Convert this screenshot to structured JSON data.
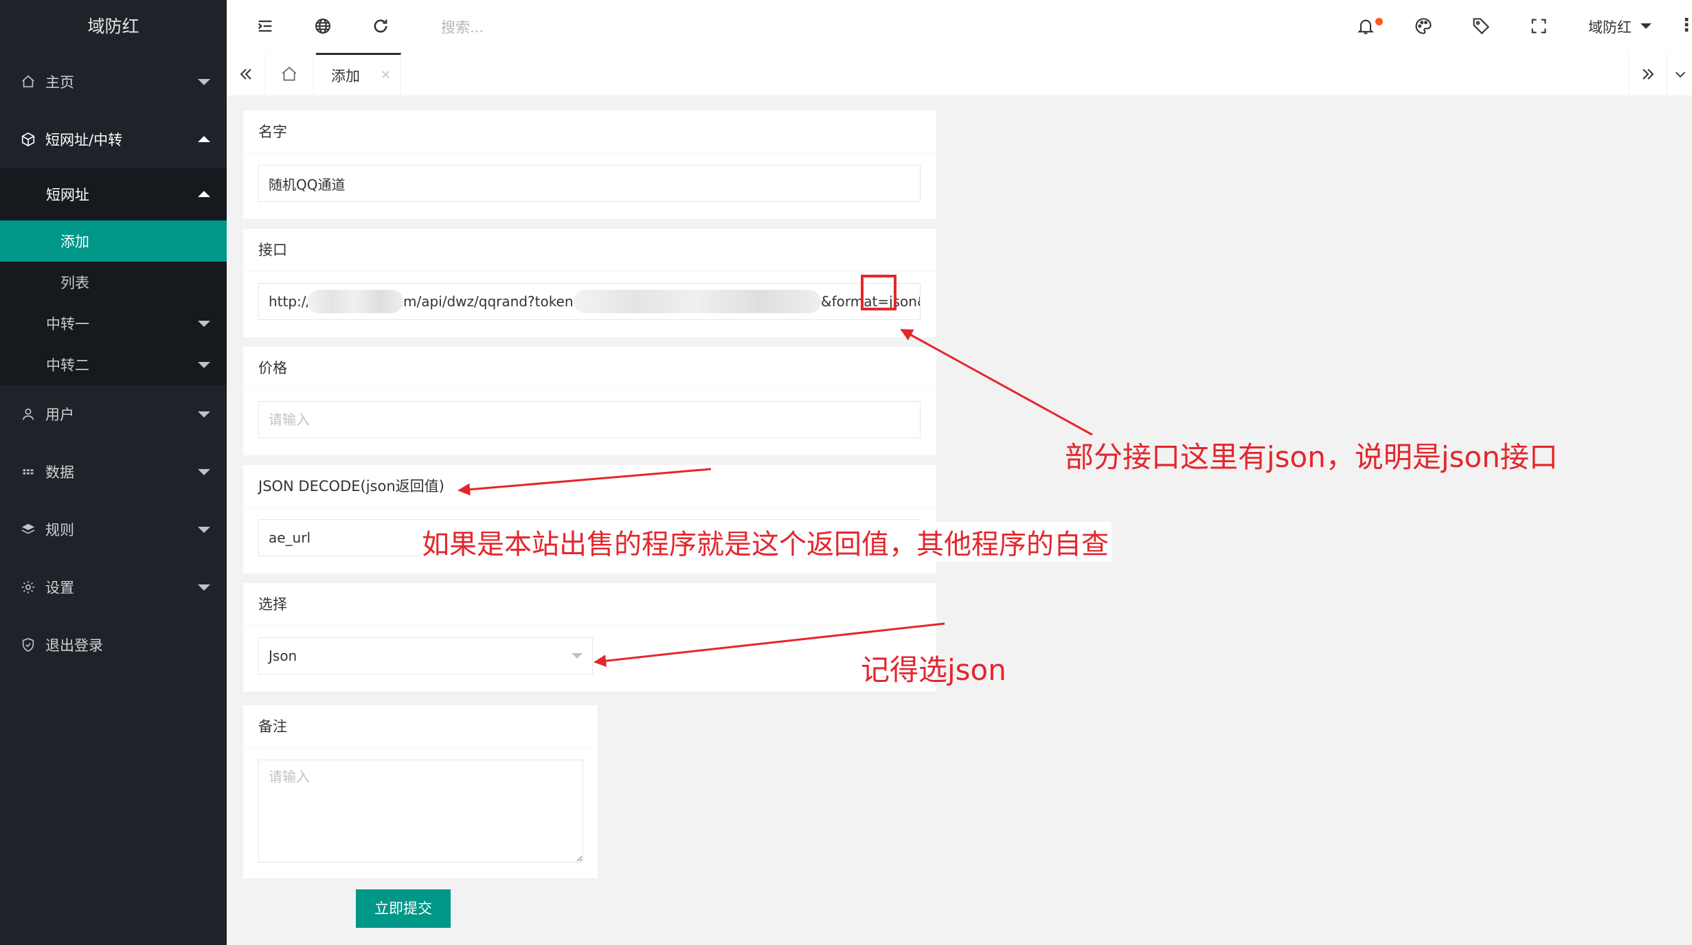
{
  "app": {
    "brand": "域防红"
  },
  "sidebar": {
    "items": [
      {
        "label": "主页",
        "icon": "home-icon"
      },
      {
        "label": "短网址/中转",
        "icon": "box-icon"
      },
      {
        "label": "用户",
        "icon": "user-icon"
      },
      {
        "label": "数据",
        "icon": "grid-icon"
      },
      {
        "label": "规则",
        "icon": "layers-icon"
      },
      {
        "label": "设置",
        "icon": "gear-icon"
      },
      {
        "label": "退出登录",
        "icon": "shield-icon"
      }
    ],
    "sub": {
      "short_url": "短网址",
      "add": "添加",
      "list": "列表",
      "relay1": "中转一",
      "relay2": "中转二"
    }
  },
  "header": {
    "search_placeholder": "搜索...",
    "user": "域防红",
    "more": "⋮",
    "icons": [
      "menu-fold-icon",
      "globe-icon",
      "refresh-icon",
      "bell-icon",
      "palette-icon",
      "tag-icon",
      "fullscreen-icon"
    ]
  },
  "tabs": {
    "active": "添加",
    "close": "×"
  },
  "form": {
    "name": {
      "label": "名字",
      "value": "随机QQ通道"
    },
    "api": {
      "label": "接口",
      "seg1": "http://c",
      "seg2": "m/api/dwz/qqrand?token=",
      "seg3": "&format=json&long"
    },
    "price": {
      "label": "价格",
      "placeholder": "请输入"
    },
    "json_decode": {
      "label": "JSON DECODE(json返回值)",
      "value": "ae_url"
    },
    "select": {
      "label": "选择",
      "value": "Json"
    },
    "remark": {
      "label": "备注",
      "placeholder": "请输入"
    },
    "submit": "立即提交"
  },
  "annotations": {
    "a1": "部分接口这里有json，说明是json接口",
    "a2": "如果是本站出售的程序就是这个返回值，其他程序的自查",
    "a3": "记得选json"
  },
  "colors": {
    "sidebar_bg": "#20222a",
    "accent": "#009688",
    "annotation": "#e4262c",
    "notify": "#ff5722"
  }
}
